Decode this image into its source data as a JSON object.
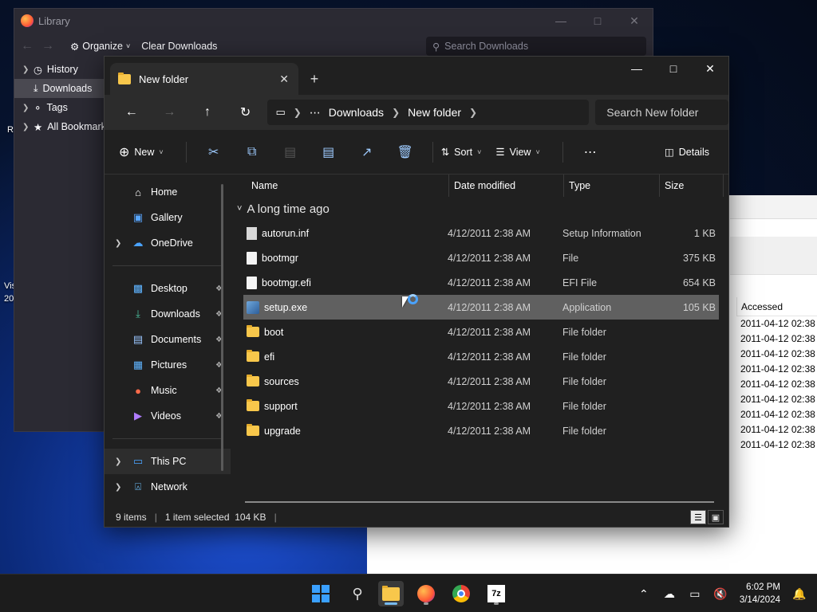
{
  "desktop": {
    "labels": [
      "Re",
      "Vis",
      "20"
    ]
  },
  "bg_window": {
    "column_header": "Accessed",
    "accessed": [
      "2011-04-12 02:38",
      "2011-04-12 02:38",
      "2011-04-12 02:38",
      "2011-04-12 02:38",
      "2011-04-12 02:38",
      "2011-04-12 02:38",
      "2011-04-12 02:38",
      "2011-04-12 02:38",
      "2011-04-12 02:38"
    ]
  },
  "library": {
    "title": "Library",
    "organize": "Organize",
    "clear_downloads": "Clear Downloads",
    "search_placeholder": "Search Downloads",
    "sidebar": [
      "History",
      "Downloads",
      "Tags",
      "All Bookmarks"
    ]
  },
  "explorer": {
    "tab_title": "New folder",
    "breadcrumb": [
      "Downloads",
      "New folder"
    ],
    "search_placeholder": "Search New folder",
    "commands": {
      "new": "New",
      "sort": "Sort",
      "view": "View",
      "details": "Details"
    },
    "nav": {
      "top": [
        "Home",
        "Gallery",
        "OneDrive"
      ],
      "quick": [
        "Desktop",
        "Downloads",
        "Documents",
        "Pictures",
        "Music",
        "Videos"
      ],
      "bottom": [
        "This PC",
        "Network"
      ]
    },
    "columns": [
      "Name",
      "Date modified",
      "Type",
      "Size"
    ],
    "group": "A long time ago",
    "files": [
      {
        "name": "autorun.inf",
        "date": "4/12/2011 2:38 AM",
        "type": "Setup Information",
        "size": "1 KB",
        "icon": "gear"
      },
      {
        "name": "bootmgr",
        "date": "4/12/2011 2:38 AM",
        "type": "File",
        "size": "375 KB",
        "icon": "file"
      },
      {
        "name": "bootmgr.efi",
        "date": "4/12/2011 2:38 AM",
        "type": "EFI File",
        "size": "654 KB",
        "icon": "file"
      },
      {
        "name": "setup.exe",
        "date": "4/12/2011 2:38 AM",
        "type": "Application",
        "size": "105 KB",
        "icon": "app"
      },
      {
        "name": "boot",
        "date": "4/12/2011 2:38 AM",
        "type": "File folder",
        "size": "",
        "icon": "folder"
      },
      {
        "name": "efi",
        "date": "4/12/2011 2:38 AM",
        "type": "File folder",
        "size": "",
        "icon": "folder"
      },
      {
        "name": "sources",
        "date": "4/12/2011 2:38 AM",
        "type": "File folder",
        "size": "",
        "icon": "folder"
      },
      {
        "name": "support",
        "date": "4/12/2011 2:38 AM",
        "type": "File folder",
        "size": "",
        "icon": "folder"
      },
      {
        "name": "upgrade",
        "date": "4/12/2011 2:38 AM",
        "type": "File folder",
        "size": "",
        "icon": "folder"
      }
    ],
    "status": {
      "count": "9 items",
      "selected": "1 item selected  104 KB"
    }
  },
  "taskbar": {
    "time": "6:02 PM",
    "date": "3/14/2024"
  }
}
